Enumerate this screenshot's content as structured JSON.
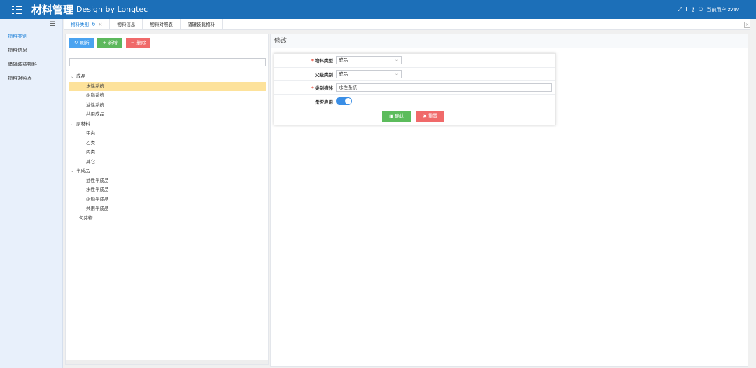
{
  "header": {
    "title_cn": "材料管理",
    "title_en": "Design by Longtec",
    "user_text": "当前用户:zvav",
    "icons": [
      "expand-icon",
      "info-icon",
      "key-icon",
      "power-icon"
    ]
  },
  "sidebar": {
    "items": [
      {
        "label": "物料类别",
        "active": true
      },
      {
        "label": "物料信息",
        "active": false
      },
      {
        "label": "储罐装载物料",
        "active": false
      },
      {
        "label": "物料对照表",
        "active": false
      }
    ]
  },
  "tabs": [
    {
      "label": "物料类别",
      "active": true
    },
    {
      "label": "物料信息",
      "active": false
    },
    {
      "label": "物料对照表",
      "active": false
    },
    {
      "label": "储罐装载物料",
      "active": false
    }
  ],
  "toolbar": {
    "refresh_label": "刷新",
    "add_label": "新增",
    "delete_label": "删除"
  },
  "search": {
    "placeholder": ""
  },
  "tree": [
    {
      "label": "成品",
      "level": 0,
      "expanded": true
    },
    {
      "label": "水性系统",
      "level": 1,
      "selected": true
    },
    {
      "label": "树脂系统",
      "level": 1
    },
    {
      "label": "油性系统",
      "level": 1
    },
    {
      "label": "共用成品",
      "level": 1
    },
    {
      "label": "原材料",
      "level": 0,
      "expanded": true
    },
    {
      "label": "甲类",
      "level": 1
    },
    {
      "label": "乙类",
      "level": 1
    },
    {
      "label": "丙类",
      "level": 1
    },
    {
      "label": "其它",
      "level": 1
    },
    {
      "label": "半成品",
      "level": 0,
      "expanded": true
    },
    {
      "label": "油性半成品",
      "level": 1
    },
    {
      "label": "水性半成品",
      "level": 1
    },
    {
      "label": "树脂半成品",
      "level": 1
    },
    {
      "label": "共用半成品",
      "level": 1
    },
    {
      "label": "包装物",
      "level": 0,
      "leaf": true
    }
  ],
  "form": {
    "panel_title": "修改",
    "material_type_label": "物料类型",
    "material_type_value": "成品",
    "parent_category_label": "父级类别",
    "parent_category_value": "成品",
    "description_label": "类别描述",
    "description_value": "水性系统",
    "enabled_label": "是否启用",
    "enabled": true,
    "confirm_label": "确认",
    "reset_label": "重置"
  },
  "colors": {
    "header_bg": "#1c6fb8",
    "accent": "#1e80d8",
    "selected_row": "#fde29b",
    "btn_blue": "#4aa3f0",
    "btn_green": "#5cb85c",
    "btn_red": "#f06a6a"
  }
}
